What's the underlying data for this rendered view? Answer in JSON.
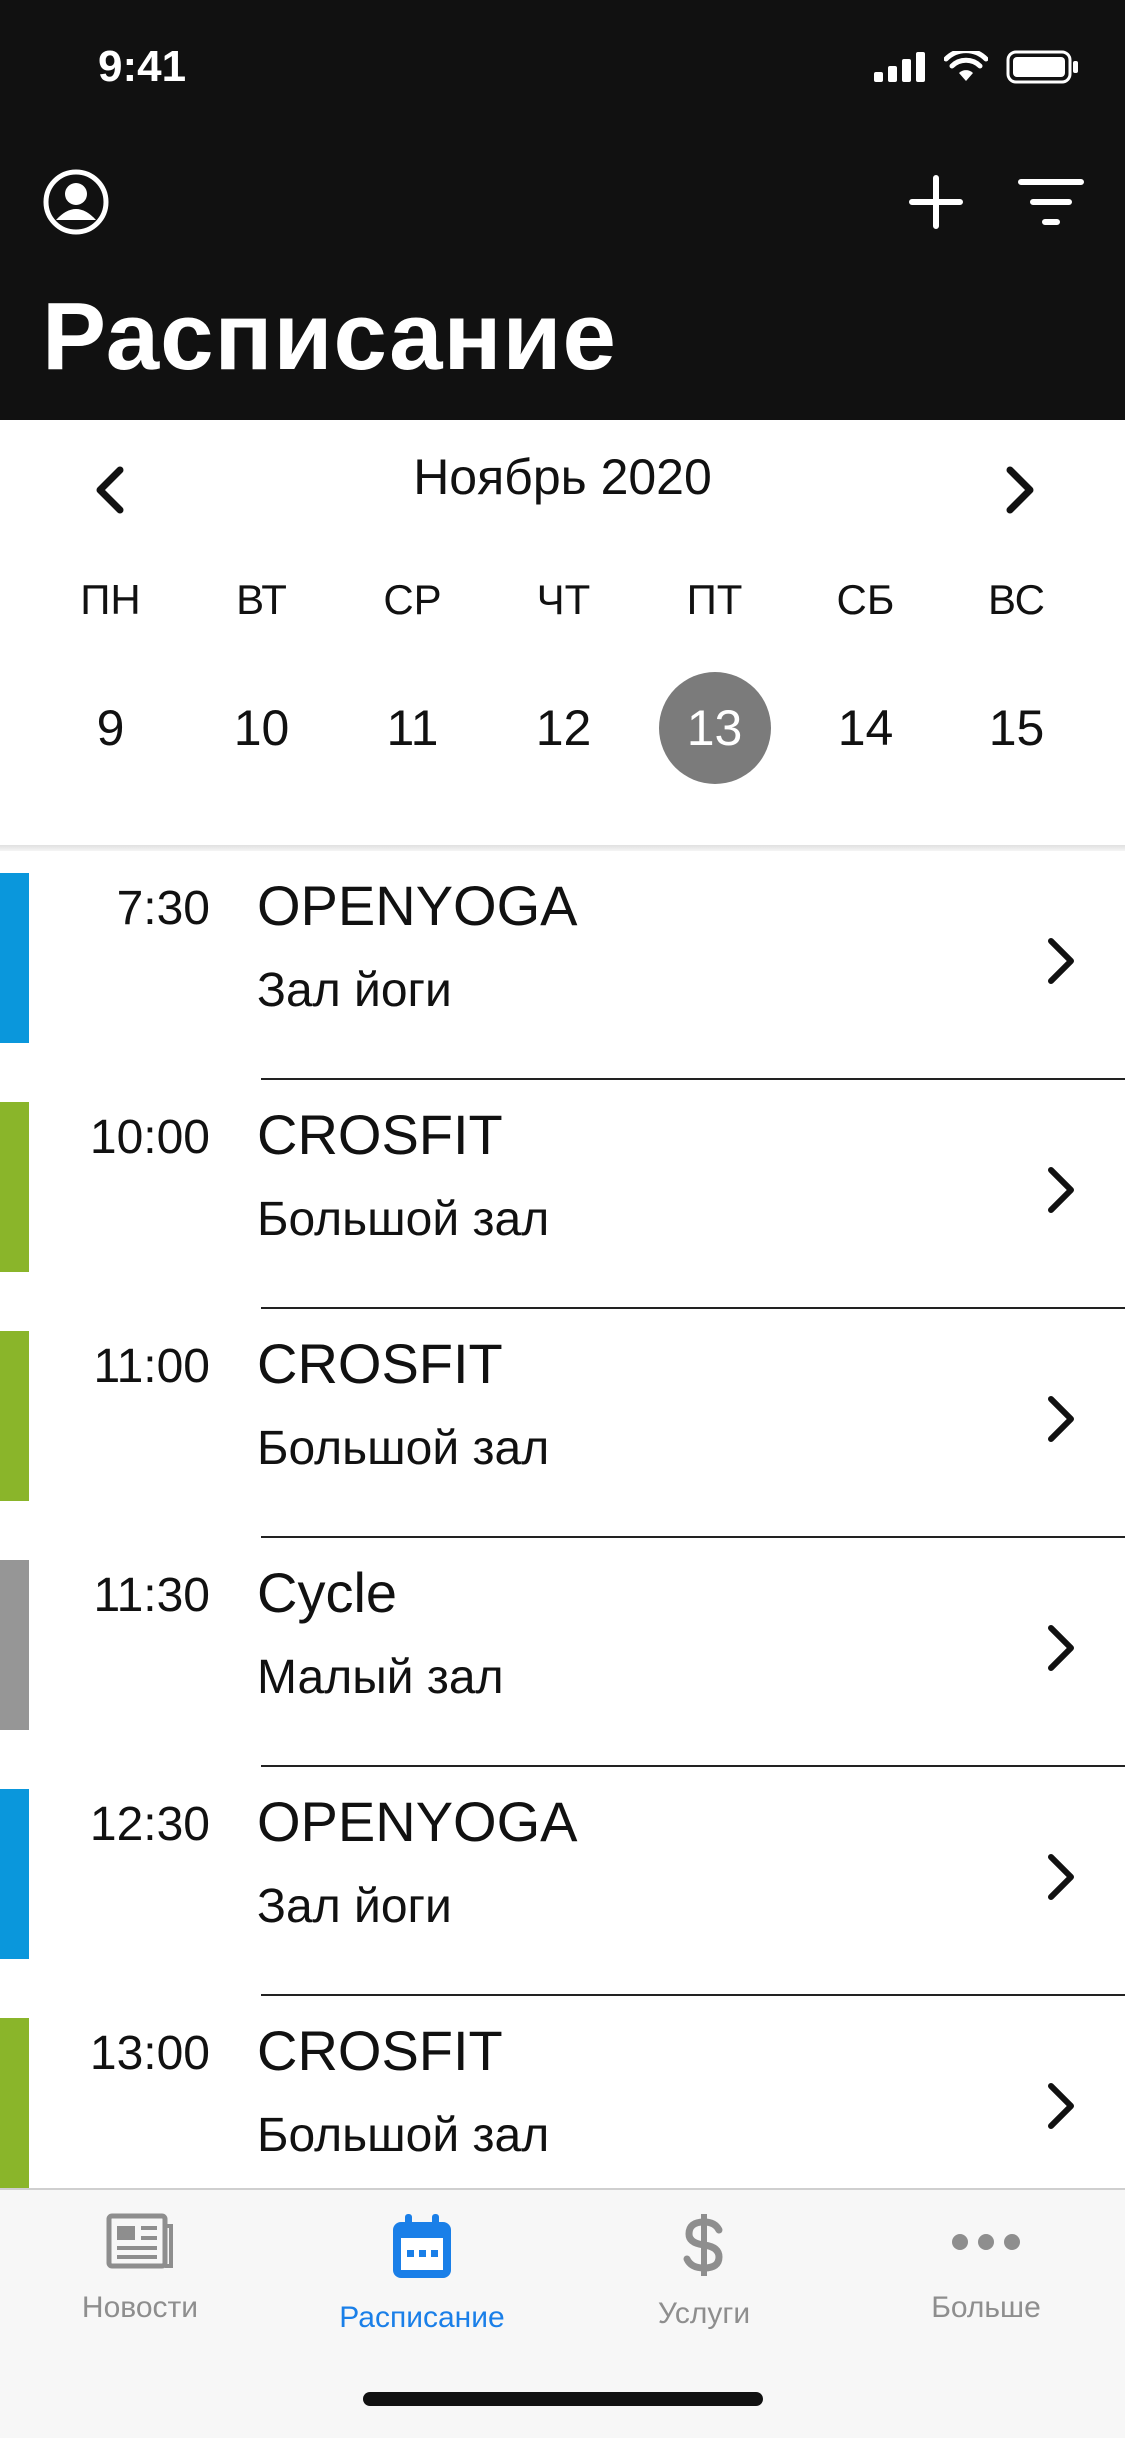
{
  "status": {
    "time": "9:41"
  },
  "header": {
    "title": "Расписание",
    "icons": [
      "profile-icon",
      "plus-icon",
      "filter-icon"
    ]
  },
  "calendar": {
    "month": "Ноябрь 2020",
    "weekdays": [
      "ПН",
      "ВТ",
      "СР",
      "ЧТ",
      "ПТ",
      "СБ",
      "ВС"
    ],
    "days": [
      "9",
      "10",
      "11",
      "12",
      "13",
      "14",
      "15"
    ],
    "selected": "13"
  },
  "events": [
    {
      "time": "7:30",
      "name": "OPENYOGA",
      "room": "Зал йоги",
      "color": "#0a97dc"
    },
    {
      "time": "10:00",
      "name": "CROSFIT",
      "room": "Большой зал",
      "color": "#8ab52a"
    },
    {
      "time": "11:00",
      "name": "CROSFIT",
      "room": "Большой зал",
      "color": "#8ab52a"
    },
    {
      "time": "11:30",
      "name": "Cycle",
      "room": "Малый зал",
      "color": "#969696"
    },
    {
      "time": "12:30",
      "name": "OPENYOGA",
      "room": "Зал йоги",
      "color": "#0a97dc"
    },
    {
      "time": "13:00",
      "name": "CROSFIT",
      "room": "Большой зал",
      "color": "#8ab52a"
    }
  ],
  "tabbar": {
    "items": [
      {
        "label": "Новости",
        "icon": "news-icon"
      },
      {
        "label": "Расписание",
        "icon": "calendar-icon"
      },
      {
        "label": "Услуги",
        "icon": "dollar-icon"
      },
      {
        "label": "Больше",
        "icon": "more-icon"
      }
    ],
    "active_color": "#1a7fe8",
    "inactive_color": "#8e8e8e"
  }
}
